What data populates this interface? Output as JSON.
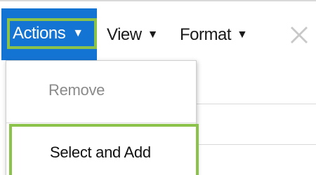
{
  "menubar": {
    "actions_label": "Actions",
    "view_label": "View",
    "format_label": "Format",
    "caret": "▼"
  },
  "dropdown": {
    "items": [
      {
        "label": "Remove",
        "enabled": false
      },
      {
        "label": "Select and Add",
        "enabled": true,
        "highlighted": true
      }
    ]
  },
  "icons": {
    "close": "close-icon"
  },
  "colors": {
    "actions_bg": "#1474d4",
    "highlight": "#8bc34a",
    "disabled_text": "#8a8a8a"
  }
}
